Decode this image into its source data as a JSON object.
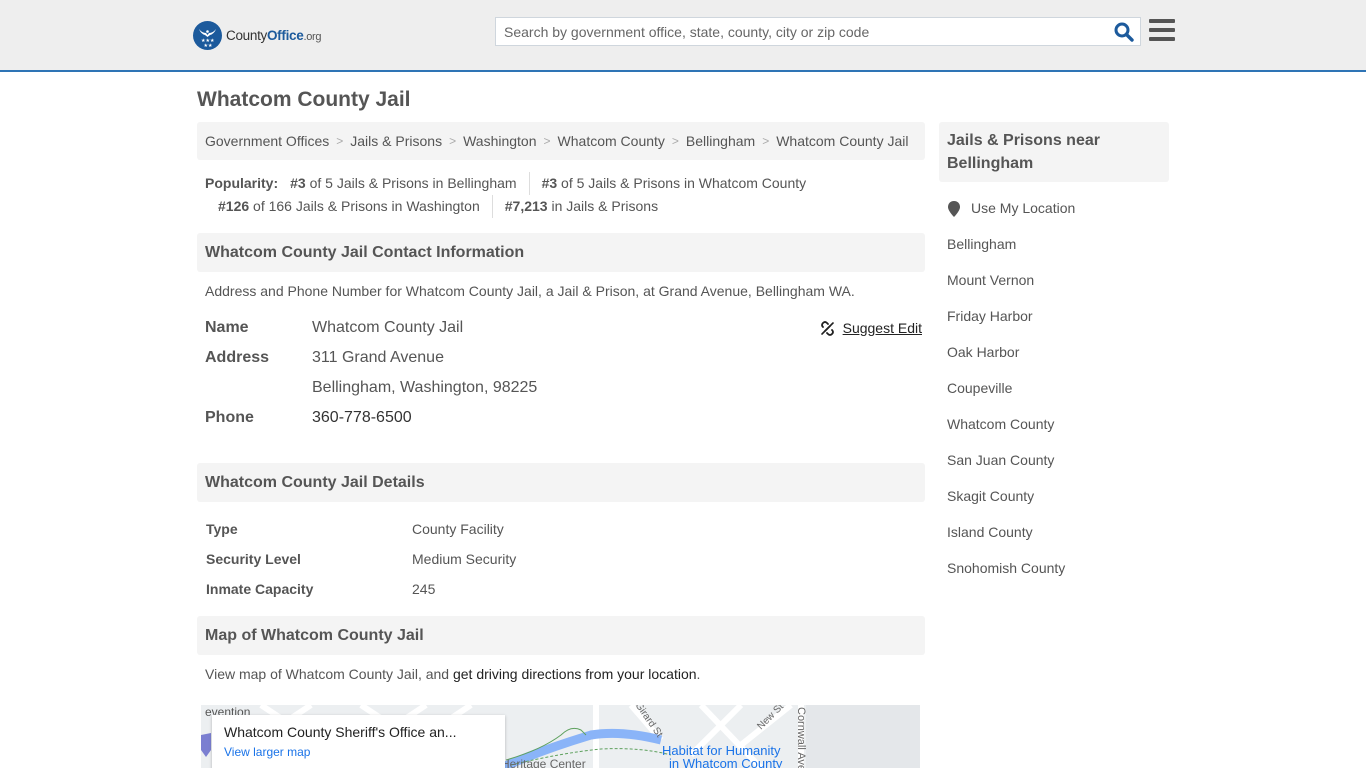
{
  "header": {
    "logo": {
      "county": "County",
      "office": "Office",
      "org": ".org"
    },
    "search_placeholder": "Search by government office, state, county, city or zip code",
    "search_value": "",
    "icons": {
      "search": "search-icon",
      "menu": "hamburger-menu-icon"
    }
  },
  "page_title": "Whatcom County Jail",
  "breadcrumb": [
    {
      "label": "Government Offices"
    },
    {
      "label": "Jails & Prisons"
    },
    {
      "label": "Washington"
    },
    {
      "label": "Whatcom County"
    },
    {
      "label": "Bellingham"
    },
    {
      "label": "Whatcom County Jail"
    }
  ],
  "popularity": {
    "label": "Popularity:",
    "items": [
      {
        "rank": "#3",
        "text": " of 5 Jails & Prisons in Bellingham"
      },
      {
        "rank": "#3",
        "text": " of 5 Jails & Prisons in Whatcom County"
      },
      {
        "rank": "#126",
        "text": " of 166 Jails & Prisons in Washington"
      },
      {
        "rank": "#7,213",
        "text": " in Jails & Prisons"
      }
    ]
  },
  "contact": {
    "heading": "Whatcom County Jail Contact Information",
    "description": "Address and Phone Number for Whatcom County Jail, a Jail & Prison, at Grand Avenue, Bellingham WA.",
    "suggest_edit": "Suggest Edit",
    "name_label": "Name",
    "name_value": "Whatcom County Jail",
    "address_label": "Address",
    "address_line1": "311 Grand Avenue",
    "address_line2": "Bellingham, Washington, 98225",
    "phone_label": "Phone",
    "phone_value": "360-778-6500"
  },
  "details": {
    "heading": "Whatcom County Jail Details",
    "rows": [
      {
        "label": "Type",
        "value": "County Facility"
      },
      {
        "label": "Security Level",
        "value": "Medium Security"
      },
      {
        "label": "Inmate Capacity",
        "value": "245"
      }
    ]
  },
  "map": {
    "heading": "Map of Whatcom County Jail",
    "desc_prefix": "View map of Whatcom County Jail, and ",
    "desc_link": "get driving directions from your location",
    "desc_suffix": ".",
    "card_title": "Whatcom County Sheriff's Office an...",
    "card_link": "View larger map",
    "labels": {
      "prevention": "evention",
      "heritage": "Heritage Center",
      "girard": "Girard St",
      "new_st": "New St",
      "cornwall": "Cornwall Ave",
      "habitat_1": "Habitat for Humanity",
      "habitat_2": "in Whatcom County"
    },
    "colors": {
      "water": "#8ab4f8",
      "poi": "#1a73e8",
      "bg": "#eceff1"
    }
  },
  "sidebar": {
    "heading": "Jails & Prisons near Bellingham",
    "use_location": "Use My Location",
    "items": [
      "Bellingham",
      "Mount Vernon",
      "Friday Harbor",
      "Oak Harbor",
      "Coupeville",
      "Whatcom County",
      "San Juan County",
      "Skagit County",
      "Island County",
      "Snohomish County"
    ]
  },
  "colors": {
    "accent": "#2e74b5",
    "logo_blue": "#1c5a9c",
    "header_bg": "#eeeeee",
    "panel_bg": "#f4f4f4",
    "text": "#555555"
  }
}
